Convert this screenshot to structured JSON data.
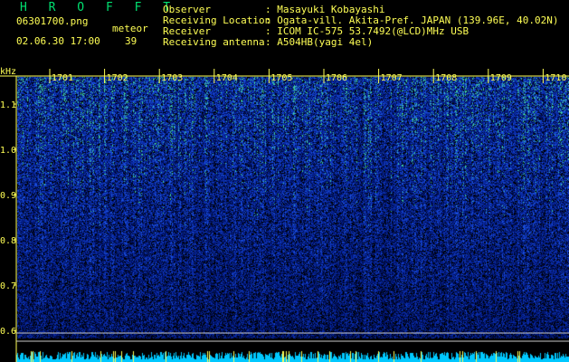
{
  "header": {
    "logo": "H R O F F T",
    "file_name": "06301700.png",
    "datetime": "02.06.30 17:00",
    "meteor_label": "meteor",
    "meteor_count": "39",
    "info_labels": [
      "Observer",
      "Receiving Location",
      "Receiver",
      "Receiving antenna"
    ],
    "info_values": [
      ": Masayuki Kobayashi",
      ": Ogata-vill. Akita-Pref. JAPAN (139.96E, 40.02N)",
      ": ICOM IC-575 53.7492(@LCD)MHz USB",
      ": A504HB(yagi 4el)"
    ]
  },
  "spectrogram": {
    "y_unit": "kHz",
    "y_ticks": [
      "1.1",
      "1.0",
      "0.9",
      "0.8",
      "0.7",
      "0.6"
    ],
    "x_ticks": [
      "1701",
      "1702",
      "1703",
      "1704",
      "1705",
      "1706",
      "1707",
      "1708",
      "1709",
      "1710"
    ],
    "colors": {
      "background": "#000000",
      "text": "#ffff55",
      "logo": "#00e070",
      "noise_low": "#001060",
      "noise_mid": "#1a50e0",
      "noise_high": "#40d0a0",
      "baseline": "#00c8ff"
    }
  }
}
